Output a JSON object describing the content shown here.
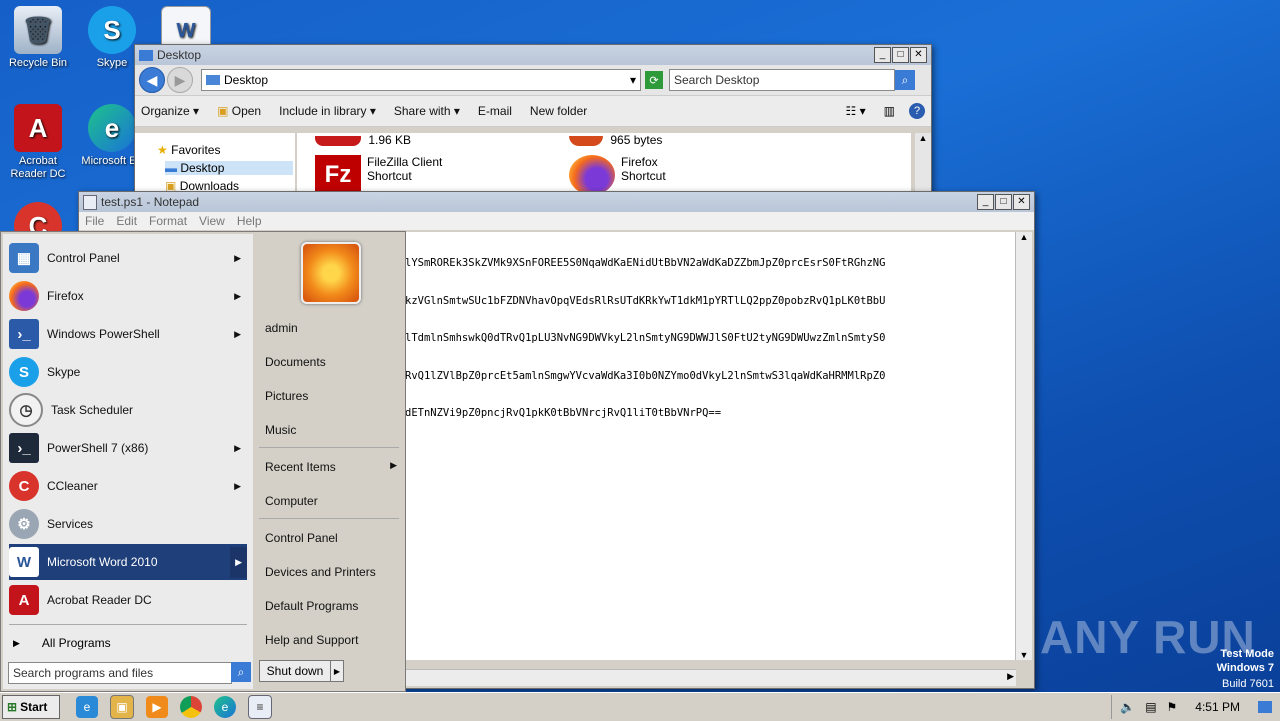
{
  "desktop": {
    "icons": [
      {
        "label": "Recycle Bin"
      },
      {
        "label": "Skype"
      },
      {
        "label": "Acrobat Reader DC"
      },
      {
        "label": "Microsoft Ed"
      }
    ],
    "watermark": {
      "brand": "ANY RUN",
      "mode": "Test Mode",
      "os": "Windows 7",
      "build": "Build 7601"
    }
  },
  "explorer": {
    "title": "Desktop",
    "address": "Desktop",
    "search_placeholder": "Search Desktop",
    "toolbar": [
      "Organize",
      "Include in library",
      "Share with",
      "E-mail",
      "New folder"
    ],
    "open_label": "Open",
    "nav": {
      "favorites": "Favorites",
      "desktop": "Desktop",
      "downloads": "Downloads"
    },
    "files": [
      {
        "name": "",
        "type": "",
        "size": "1.96 KB"
      },
      {
        "name": "",
        "type": "",
        "size": "965 bytes"
      },
      {
        "name": "FileZilla Client",
        "type": "Shortcut",
        "size": ""
      },
      {
        "name": "Firefox",
        "type": "Shortcut",
        "size": ""
      }
    ]
  },
  "notepad": {
    "title": "test.ps1 - Notepad",
    "menu": [
      "File",
      "Edit",
      "Format",
      "View",
      "Help"
    ],
    "lines": [
      "lYSmROREk3SkZVMk9XSnFOREE5S0NqaWdKaENidUtBbVN2aWdKaDZZbmJpZ0prcEsrS0FtRGhzNG",
      "kzVGlnSmtwSUc1bFZDNVhavOpqVEdsRlRsUTdKRkYwT1dkM1pYRTlLQ2ppZ0pobzRvQ1pLK0tBbU",
      "lTdmlnSmhswkQ0dTRvQ1pLU3NvNG9DWVkyL2lnSmtyNG9DWWJlS0FtU2tyNG9DWUwzZmlnSmtyS0",
      "RvQ1lZVlBpZ0prcEt5amlnSmgwYVcvaWdKa3I0b0NZYmo0dVkyL2lnSmtwS3lqaWdKaHRMMlRpZ0",
      "dETnNZVi9pZ0pncjRvQ1pkK0tBbVNrcjRvQ1liT0tBbVNrPQ=="
    ]
  },
  "start_menu": {
    "programs": [
      {
        "label": "Control Panel",
        "icon": "control-panel-icon",
        "arrow": true
      },
      {
        "label": "Firefox",
        "icon": "firefox-icon",
        "arrow": true
      },
      {
        "label": "Windows PowerShell",
        "icon": "powershell-icon",
        "arrow": true
      },
      {
        "label": "Skype",
        "icon": "skype-icon",
        "arrow": false
      },
      {
        "label": "Task Scheduler",
        "icon": "task-scheduler-icon",
        "arrow": false
      },
      {
        "label": "PowerShell 7 (x86)",
        "icon": "powershell7-icon",
        "arrow": true
      },
      {
        "label": "CCleaner",
        "icon": "ccleaner-icon",
        "arrow": true
      },
      {
        "label": "Services",
        "icon": "services-icon",
        "arrow": false
      },
      {
        "label": "Microsoft Word 2010",
        "icon": "word-icon",
        "arrow": true
      },
      {
        "label": "Acrobat Reader DC",
        "icon": "acrobat-icon",
        "arrow": false
      }
    ],
    "all_programs": "All Programs",
    "search_placeholder": "Search programs and files",
    "right": [
      "admin",
      "Documents",
      "Pictures",
      "Music",
      "Recent Items",
      "Computer",
      "Control Panel",
      "Devices and Printers",
      "Default Programs",
      "Help and Support"
    ],
    "shutdown": "Shut down"
  },
  "taskbar": {
    "start": "Start",
    "clock": "4:51 PM"
  }
}
